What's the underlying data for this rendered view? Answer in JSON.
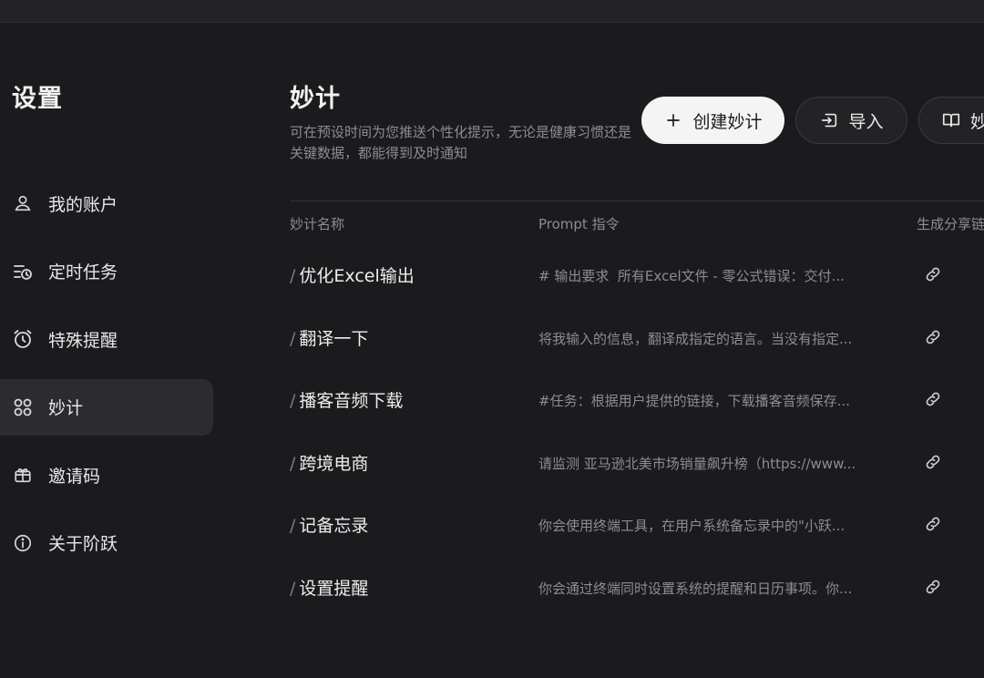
{
  "sidebar": {
    "title": "设置",
    "items": [
      {
        "label": "我的账户",
        "icon": "user-icon",
        "active": false
      },
      {
        "label": "定时任务",
        "icon": "scheduled-task-icon",
        "active": false
      },
      {
        "label": "特殊提醒",
        "icon": "alarm-clock-icon",
        "active": false
      },
      {
        "label": "妙计",
        "icon": "grid-icon",
        "active": true
      },
      {
        "label": "邀请码",
        "icon": "gift-icon",
        "active": false
      },
      {
        "label": "关于阶跃",
        "icon": "info-icon",
        "active": false
      }
    ]
  },
  "main": {
    "title": "妙计",
    "description": "可在预设时间为您推送个性化提示，无论是健康习惯还是关键数据，都能得到及时通知",
    "buttons": {
      "create_label": "创建妙计",
      "import_label": "导入",
      "third_label": "妙"
    },
    "columns": {
      "name": "妙计名称",
      "prompt": "Prompt 指令",
      "share": "生成分享链"
    },
    "rows": [
      {
        "name": "优化Excel输出",
        "prompt": "# 输出要求 ￼ 所有Excel文件 - 零公式错误：交付..."
      },
      {
        "name": "翻译一下",
        "prompt": "将我输入的信息，翻译成指定的语言。当没有指定..."
      },
      {
        "name": "播客音频下载",
        "prompt": "#任务：根据用户提供的链接，下载播客音频保存..."
      },
      {
        "name": "跨境电商",
        "prompt": "请监测 亚马逊北美市场销量飙升榜（https://www..."
      },
      {
        "name": "记备忘录",
        "prompt": "你会使用终端工具，在用户系统备忘录中的\"小跃..."
      },
      {
        "name": "设置提醒",
        "prompt": "你会通过终端同时设置系统的提醒和日历事项。你..."
      }
    ]
  },
  "colors": {
    "background": "#1b1b1d",
    "active_nav": "#2c2c2f",
    "primary_button": "#f4f4f5",
    "muted_text": "#8d8d92"
  }
}
